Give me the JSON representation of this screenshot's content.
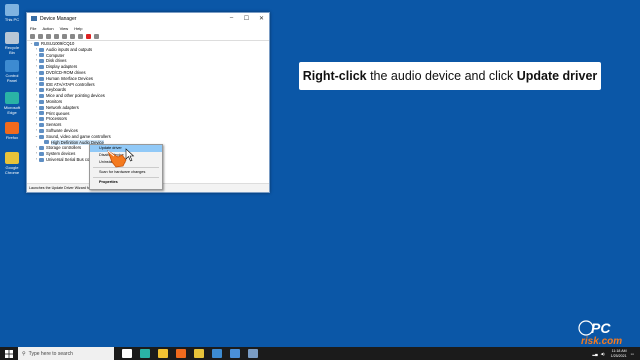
{
  "desktop": {
    "icons": [
      {
        "label": "This PC",
        "color": "#7fb3e0"
      },
      {
        "label": "Recycle Bin",
        "color": "#b8c7d6"
      },
      {
        "label": "Control Panel",
        "color": "#3d8bd1"
      },
      {
        "label": "Microsoft Edge",
        "color": "#2ab3a6"
      },
      {
        "label": "Firefox",
        "color": "#f06a1d"
      },
      {
        "label": "Google Chrome",
        "color": "#e8c33a"
      }
    ]
  },
  "window": {
    "title": "Device Manager",
    "menu": [
      "File",
      "Action",
      "View",
      "Help"
    ],
    "controls": {
      "minimize": "–",
      "maximize": "☐",
      "close": "✕"
    },
    "tree": [
      {
        "label": "RUSU1009/CQ10",
        "level": 0,
        "expander": "⌄"
      },
      {
        "label": "Audio inputs and outputs",
        "level": 1,
        "expander": "›"
      },
      {
        "label": "Computer",
        "level": 1,
        "expander": "›"
      },
      {
        "label": "Disk drives",
        "level": 1,
        "expander": "›"
      },
      {
        "label": "Display adapters",
        "level": 1,
        "expander": "›"
      },
      {
        "label": "DVD/CD-ROM drives",
        "level": 1,
        "expander": "›"
      },
      {
        "label": "Human Interface Devices",
        "level": 1,
        "expander": "›"
      },
      {
        "label": "IDE ATA/ATAPI controllers",
        "level": 1,
        "expander": "›"
      },
      {
        "label": "Keyboards",
        "level": 1,
        "expander": "›"
      },
      {
        "label": "Mice and other pointing devices",
        "level": 1,
        "expander": "›"
      },
      {
        "label": "Monitors",
        "level": 1,
        "expander": "›"
      },
      {
        "label": "Network adapters",
        "level": 1,
        "expander": "›"
      },
      {
        "label": "Print queues",
        "level": 1,
        "expander": "›"
      },
      {
        "label": "Processors",
        "level": 1,
        "expander": "›"
      },
      {
        "label": "Sensors",
        "level": 1,
        "expander": "›"
      },
      {
        "label": "Software devices",
        "level": 1,
        "expander": "›"
      },
      {
        "label": "Sound, video and game controllers",
        "level": 1,
        "expander": "⌄"
      },
      {
        "label": "High Definition Audio Device",
        "level": 2,
        "expander": "",
        "selected": true
      },
      {
        "label": "Storage controllers",
        "level": 1,
        "expander": "›"
      },
      {
        "label": "System devices",
        "level": 1,
        "expander": "›"
      },
      {
        "label": "Universal Serial Bus controllers",
        "level": 1,
        "expander": "›"
      }
    ],
    "status": "Launches the Update Driver Wizard for the selected device."
  },
  "context_menu": {
    "items": [
      "Update driver",
      "Disable device",
      "Uninstall device",
      "Scan for hardware changes",
      "Properties"
    ],
    "highlighted": "Update driver"
  },
  "callout": {
    "part1": "Right-click",
    "part2": " the audio device and click ",
    "part3": "Update driver"
  },
  "taskbar": {
    "search_placeholder": "Type here to search",
    "apps": [
      {
        "name": "task-view",
        "color": "#ffffff"
      },
      {
        "name": "edge",
        "color": "#2ab3a6"
      },
      {
        "name": "file-explorer",
        "color": "#f2c233"
      },
      {
        "name": "firefox",
        "color": "#f06a1d"
      },
      {
        "name": "chrome",
        "color": "#e8c33a"
      },
      {
        "name": "edge-alt",
        "color": "#3d8bd1"
      },
      {
        "name": "store",
        "color": "#4a90d9"
      },
      {
        "name": "device-manager",
        "color": "#7a9cc4"
      }
    ],
    "time": "11:18 AM",
    "date": "1/25/2021"
  },
  "watermark": {
    "text1": "PC",
    "text2": "risk.com"
  }
}
